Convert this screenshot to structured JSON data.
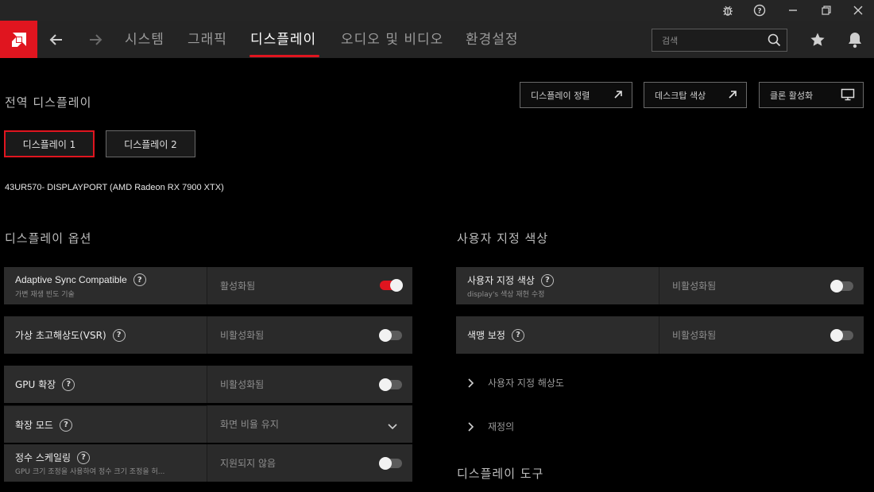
{
  "titlebar": {
    "icons": [
      "bug-report-icon",
      "help-icon",
      "minimize-icon",
      "restore-icon",
      "close-icon"
    ]
  },
  "nav": {
    "tabs": [
      {
        "label": "시스템"
      },
      {
        "label": "그래픽"
      },
      {
        "label": "디스플레이"
      },
      {
        "label": "오디오 및 비디오"
      },
      {
        "label": "환경설정"
      }
    ],
    "active_tab": "디스플레이",
    "search_placeholder": "검색",
    "accent_color": "#e0151f"
  },
  "global_display": {
    "title": "전역 디스플레이",
    "buttons": {
      "arrange": "디스플레이 정렬",
      "desktop_color": "데스크탑 색상",
      "clone": "클론 활성화"
    },
    "display_tabs": [
      "디스플레이 1",
      "디스플레이 2"
    ],
    "selected_display": "디스플레이 1",
    "monitor": "43UR570- DISPLAYPORT (AMD Radeon RX 7900 XTX)"
  },
  "display_options": {
    "title": "디스플레이 옵션",
    "rows": [
      {
        "label": "Adaptive Sync Compatible",
        "sub": "가변 재생 빈도 기술",
        "value": "활성화됨",
        "toggle": true
      },
      {
        "label": "가상 초고해상도(VSR)",
        "sub": "",
        "value": "비활성화됨",
        "toggle": false
      },
      {
        "label": "GPU 확장",
        "sub": "",
        "value": "비활성화됨",
        "toggle": false
      },
      {
        "label": "확장 모드",
        "sub": "",
        "value": "화면 비율 유지"
      },
      {
        "label": "정수 스케일링",
        "sub": "GPU 크기 조정을 사용하여 정수 크기 조정을 허...",
        "value": "지원되지 않음",
        "toggle": false
      }
    ]
  },
  "custom_color": {
    "title": "사용자 지정 색상",
    "rows": [
      {
        "label": "사용자 지정 색상",
        "sub": "display's 색상 재현 수정",
        "value": "비활성화됨",
        "toggle": false
      },
      {
        "label": "색맹 보정",
        "sub": "",
        "value": "비활성화됨",
        "toggle": false
      }
    ],
    "expanders": [
      "사용자 지정 해상도",
      "재정의"
    ]
  },
  "display_tools": {
    "title": "디스플레이 도구"
  }
}
